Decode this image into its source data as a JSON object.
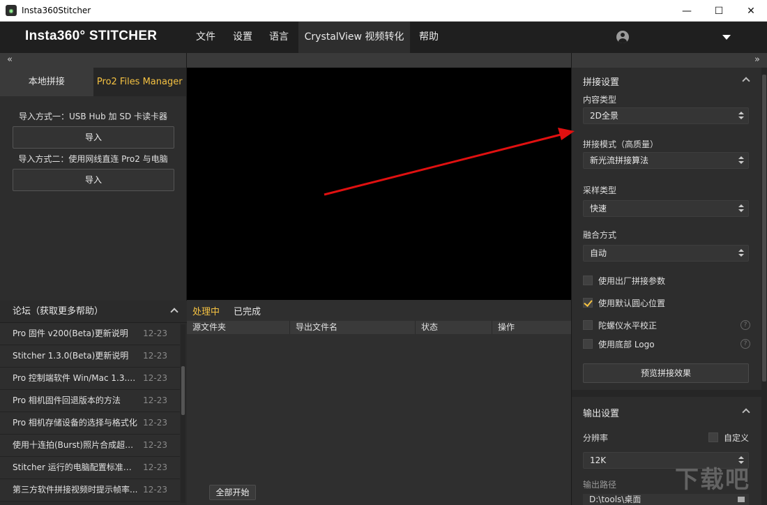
{
  "window": {
    "title": "Insta360Stitcher",
    "minimize": "—",
    "maximize": "☐",
    "close": "✕"
  },
  "menubar": {
    "brand": "Insta360° STITCHER",
    "items": [
      "文件",
      "设置",
      "语言",
      "CrystalView 视频转化",
      "帮助"
    ]
  },
  "left": {
    "collapse": "«",
    "tabs": [
      "本地拼接",
      "Pro2 Files Manager"
    ],
    "import1_label": "导入方式一：USB Hub 加 SD 卡读卡器",
    "import1_button": "导入",
    "import2_label": "导入方式二：使用网线直连 Pro2 与电脑",
    "import2_button": "导入",
    "forum": {
      "title": "论坛（获取更多帮助）",
      "items": [
        {
          "title": "Pro 固件 v200(Beta)更新说明",
          "date": "12-23"
        },
        {
          "title": "Stitcher 1.3.0(Beta)更新说明",
          "date": "12-23"
        },
        {
          "title": "Pro 控制端软件 Win/Mac 1.3.0...",
          "date": "12-23"
        },
        {
          "title": "Pro 相机固件回退版本的方法",
          "date": "12-23"
        },
        {
          "title": "Pro 相机存储设备的选择与格式化",
          "date": "12-23"
        },
        {
          "title": "使用十连拍(Burst)照片合成超分...",
          "date": "12-23"
        },
        {
          "title": "Stitcher 运行的电脑配置标准推荐",
          "date": "12-23"
        },
        {
          "title": "第三方软件拼接视频时提示帧率...",
          "date": "12-23"
        }
      ]
    }
  },
  "center": {
    "task_tabs": [
      "处理中",
      "已完成"
    ],
    "columns": [
      "源文件夹",
      "导出文件名",
      "状态",
      "操作"
    ],
    "start_all": "全部开始"
  },
  "right": {
    "expand": "»",
    "stitch_settings": {
      "title": "拼接设置",
      "content_type_label": "内容类型",
      "content_type_value": "2D全景",
      "stitch_mode_label": "拼接模式（高质量）",
      "stitch_mode_value": "新光流拼接算法",
      "sampling_label": "采样类型",
      "sampling_value": "快速",
      "blend_label": "融合方式",
      "blend_value": "自动",
      "checks": [
        {
          "label": "使用出厂拼接参数",
          "checked": false
        },
        {
          "label": "使用默认圆心位置",
          "checked": true
        },
        {
          "label": "陀螺仪水平校正",
          "checked": false
        },
        {
          "label": "使用底部 Logo",
          "checked": false
        }
      ],
      "preview_button": "预览拼接效果"
    },
    "output_settings": {
      "title": "输出设置",
      "resolution_label": "分辨率",
      "custom_label": "自定义",
      "resolution_value": "12K",
      "path_label": "输出路径",
      "path_value": "D:\\tools\\桌面"
    }
  },
  "watermark": "下载吧",
  "colors": {
    "accent": "#f5c242",
    "arrow": "#e01010"
  }
}
